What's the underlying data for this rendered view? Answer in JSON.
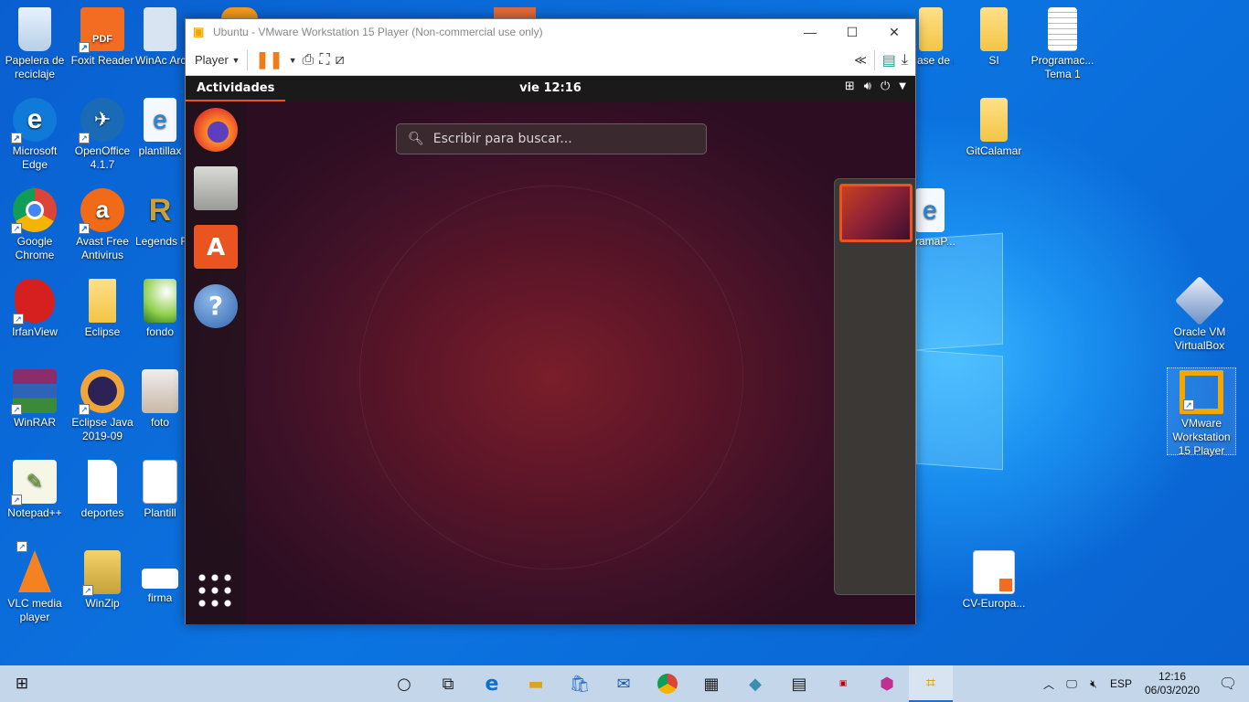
{
  "desktop": {
    "icons": [
      {
        "label": "Papelera de reciclaje",
        "icon": "recycle-bin-icon"
      },
      {
        "label": "Foxit Reader",
        "icon": "foxit-pdf-icon"
      },
      {
        "label": "WinAc Archive",
        "icon": "winace-archive-icon"
      },
      {
        "label": "Microsoft Edge",
        "icon": "edge-icon"
      },
      {
        "label": "OpenOffice 4.1.7",
        "icon": "openoffice-icon"
      },
      {
        "label": "plantillax",
        "icon": "ie-document-icon"
      },
      {
        "label": "Google Chrome",
        "icon": "chrome-icon"
      },
      {
        "label": "Avast Free Antivirus",
        "icon": "avast-icon"
      },
      {
        "label": "Legends Runeter",
        "icon": "legends-runeterra-icon"
      },
      {
        "label": "IrfanView",
        "icon": "irfanview-icon"
      },
      {
        "label": "Eclipse",
        "icon": "folder-icon"
      },
      {
        "label": "fondo",
        "icon": "image-file-icon"
      },
      {
        "label": "WinRAR",
        "icon": "winrar-icon"
      },
      {
        "label": "Eclipse Java 2019-09",
        "icon": "eclipse-icon"
      },
      {
        "label": "foto",
        "icon": "photo-icon"
      },
      {
        "label": "Notepad++",
        "icon": "notepadpp-icon"
      },
      {
        "label": "deportes",
        "icon": "blank-file-icon"
      },
      {
        "label": "Plantill",
        "icon": "document-thumbnail-icon"
      },
      {
        "label": "VLC media player",
        "icon": "vlc-icon"
      },
      {
        "label": "WinZip",
        "icon": "winzip-icon"
      },
      {
        "label": "firma",
        "icon": "signature-image-icon"
      },
      {
        "label": "ase de atos",
        "icon": "folder-icon"
      },
      {
        "label": "SI",
        "icon": "folder-icon"
      },
      {
        "label": "Programac... Tema 1",
        "icon": "text-file-icon"
      },
      {
        "label": "GitCalamar",
        "icon": "folder-icon"
      },
      {
        "label": "ramaP...",
        "icon": "ie-document-icon"
      },
      {
        "label": "Oracle VM VirtualBox",
        "icon": "virtualbox-icon"
      },
      {
        "label": "VMware Workstation 15 Player",
        "icon": "vmware-icon"
      },
      {
        "label": "CV-Europa...",
        "icon": "pdf-document-icon"
      }
    ]
  },
  "vmware": {
    "title": "Ubuntu - VMware Workstation 15 Player (Non-commercial use only)",
    "player_menu": "Player",
    "minimize": "—",
    "maximize": "☐",
    "close": "✕"
  },
  "ubuntu": {
    "activities": "Actividades",
    "clock": "vie 12:16",
    "search_placeholder": "Escribir para buscar...",
    "dock_apps": [
      "firefox-icon",
      "files-icon",
      "software-icon",
      "help-icon"
    ],
    "show_apps": "show-applications-icon"
  },
  "taskbar": {
    "lang": "ESP",
    "time": "12:16",
    "date": "06/03/2020"
  },
  "colors": {
    "ubuntu_orange": "#e95420",
    "win_blue": "#0b74e0"
  }
}
